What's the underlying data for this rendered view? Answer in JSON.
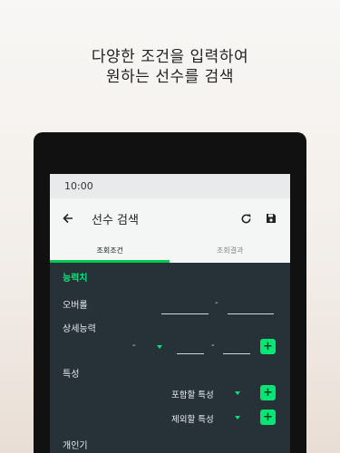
{
  "promo": {
    "line1": "다양한 조건을 입력하여",
    "line2": "원하는 선수를 검색"
  },
  "status": {
    "time": "10:00"
  },
  "appbar": {
    "title": "선수 검색",
    "back_icon": "arrow-left-icon",
    "refresh_icon": "refresh-icon",
    "save_icon": "save-icon"
  },
  "tabs": [
    {
      "label": "조회조건",
      "active": true
    },
    {
      "label": "조회결과",
      "active": false
    }
  ],
  "form": {
    "section_ability": "능력치",
    "overall_label": "오버롤",
    "range_sep": "-",
    "detail_label": "상세능력",
    "detail_select": "-",
    "traits_label": "특성",
    "include_trait": "포함할 특성",
    "exclude_trait": "제외할 특성",
    "personal_label": "개인기",
    "add_label": "+"
  },
  "colors": {
    "accent": "#00e676",
    "screen_bg": "#263238",
    "appbar_bg": "#f4f5f5"
  }
}
